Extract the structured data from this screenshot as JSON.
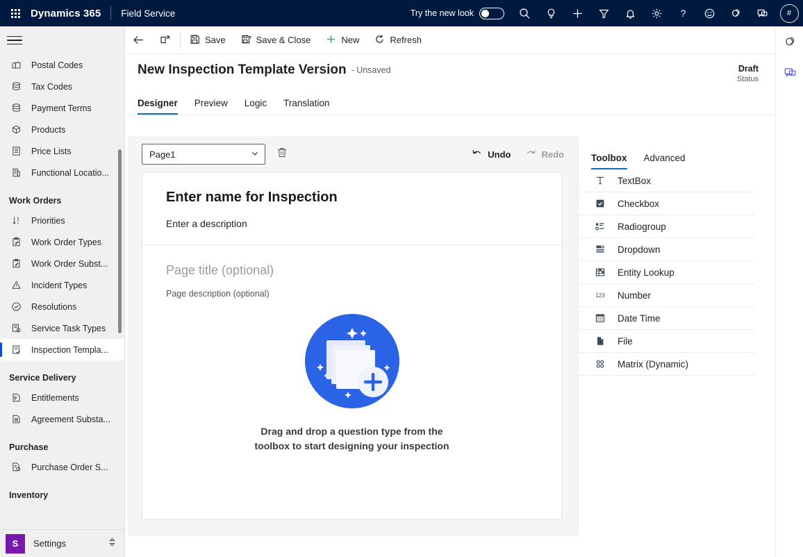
{
  "header": {
    "waffle_icon": "app-launcher-icon",
    "brand": "Dynamics 365",
    "app_name": "Field Service",
    "new_look_label": "Try the new look",
    "new_look_toggle_state": "off",
    "icons": [
      {
        "name": "search-icon",
        "label": "Search"
      },
      {
        "name": "lightbulb-icon",
        "label": "Insights"
      },
      {
        "name": "plus-icon",
        "label": "Quick create"
      },
      {
        "name": "filter-icon",
        "label": "Filter"
      },
      {
        "name": "bell-icon",
        "label": "Notifications"
      },
      {
        "name": "gear-icon",
        "label": "Settings"
      },
      {
        "name": "help-icon",
        "label": "Help"
      },
      {
        "name": "smiley-icon",
        "label": "Feedback"
      },
      {
        "name": "copilot-icon",
        "label": "Copilot"
      },
      {
        "name": "chat-icon",
        "label": "Chat"
      }
    ],
    "avatar_text": "#",
    "background_color": "#001a3f"
  },
  "sidebar": {
    "hamburger_icon": "hamburger-menu-icon",
    "items": [
      {
        "label": "Postal Codes",
        "icon": "mailbox-icon",
        "selected": false
      },
      {
        "label": "Tax Codes",
        "icon": "stack-icon",
        "selected": false
      },
      {
        "label": "Payment Terms",
        "icon": "stack-icon",
        "selected": false
      },
      {
        "label": "Products",
        "icon": "box-icon",
        "selected": false
      },
      {
        "label": "Price Lists",
        "icon": "list-document-icon",
        "selected": false
      },
      {
        "label": "Functional Locatio...",
        "icon": "building-icon",
        "selected": false
      }
    ],
    "groups": [
      {
        "title": "Work Orders",
        "items": [
          {
            "label": "Priorities",
            "icon": "sort-arrows-icon",
            "selected": false
          },
          {
            "label": "Work Order Types",
            "icon": "clipboard-pen-icon",
            "selected": false
          },
          {
            "label": "Work Order Subst...",
            "icon": "clipboard-pen-icon",
            "selected": false
          },
          {
            "label": "Incident Types",
            "icon": "warning-triangle-icon",
            "selected": false
          },
          {
            "label": "Resolutions",
            "icon": "check-circle-icon",
            "selected": false
          },
          {
            "label": "Service Task Types",
            "icon": "task-gear-icon",
            "selected": false
          },
          {
            "label": "Inspection Templa...",
            "icon": "inspection-icon",
            "selected": true
          }
        ]
      },
      {
        "title": "Service Delivery",
        "items": [
          {
            "label": "Entitlements",
            "icon": "entitlement-icon",
            "selected": false
          },
          {
            "label": "Agreement Substa...",
            "icon": "agreement-icon",
            "selected": false
          }
        ]
      },
      {
        "title": "Purchase",
        "items": [
          {
            "label": "Purchase Order S...",
            "icon": "purchase-order-icon",
            "selected": false
          }
        ]
      },
      {
        "title": "Inventory",
        "items": []
      }
    ],
    "settings": {
      "badge_letter": "S",
      "badge_color": "#7719aa",
      "label": "Settings",
      "chevron_icon": "chevron-up-down-icon"
    }
  },
  "command_bar": {
    "back_icon": "back-arrow-icon",
    "popout_icon": "open-in-new-window-icon",
    "buttons": [
      {
        "label": "Save",
        "icon": "save-icon"
      },
      {
        "label": "Save & Close",
        "icon": "save-close-icon"
      },
      {
        "label": "New",
        "icon": "plus-icon"
      },
      {
        "label": "Refresh",
        "icon": "refresh-icon"
      }
    ]
  },
  "record": {
    "title": "New Inspection Template Version",
    "subtitle": "- Unsaved",
    "status_value": "Draft",
    "status_label": "Status",
    "tabs": [
      {
        "label": "Designer",
        "active": true
      },
      {
        "label": "Preview",
        "active": false
      },
      {
        "label": "Logic",
        "active": false
      },
      {
        "label": "Translation",
        "active": false
      }
    ]
  },
  "designer": {
    "page_select_value": "Page1",
    "page_select_chevron": "chevron-down-icon",
    "delete_icon": "trash-icon",
    "undo": {
      "label": "Undo",
      "icon": "undo-icon",
      "enabled": true
    },
    "redo": {
      "label": "Redo",
      "icon": "redo-icon",
      "enabled": false
    },
    "canvas": {
      "inspection_name_placeholder": "Enter name for Inspection",
      "inspection_description_placeholder": "Enter a description",
      "page_title_placeholder": "Page title (optional)",
      "page_description_placeholder": "Page description (optional)",
      "empty_state_illustration": "add-cards-illustration",
      "empty_state_text": "Drag and drop a question type from the toolbox to start designing your inspection",
      "illustration_colors": {
        "circle": "#2a63e6",
        "card": "#f1f4fb",
        "badge": "#eef2fd",
        "plus": "#2a63e6"
      }
    }
  },
  "toolbox": {
    "tabs": [
      {
        "label": "Toolbox",
        "active": true
      },
      {
        "label": "Advanced",
        "active": false
      }
    ],
    "items": [
      {
        "label": "TextBox",
        "icon": "textbox-icon"
      },
      {
        "label": "Checkbox",
        "icon": "checkbox-icon"
      },
      {
        "label": "Radiogroup",
        "icon": "radiogroup-icon"
      },
      {
        "label": "Dropdown",
        "icon": "dropdown-icon"
      },
      {
        "label": "Entity Lookup",
        "icon": "entity-lookup-icon"
      },
      {
        "label": "Number",
        "icon": "number-icon"
      },
      {
        "label": "Date Time",
        "icon": "calendar-icon"
      },
      {
        "label": "File",
        "icon": "file-icon"
      },
      {
        "label": "Matrix (Dynamic)",
        "icon": "matrix-icon"
      }
    ]
  },
  "right_rail": {
    "items": [
      {
        "name": "copilot-icon",
        "label": "Copilot"
      },
      {
        "name": "chat-icon",
        "label": "Chat"
      }
    ]
  },
  "colors": {
    "accent": "#0f6cbd",
    "header_bg": "#001a3f",
    "selection_bar": "#0f4bd8"
  }
}
